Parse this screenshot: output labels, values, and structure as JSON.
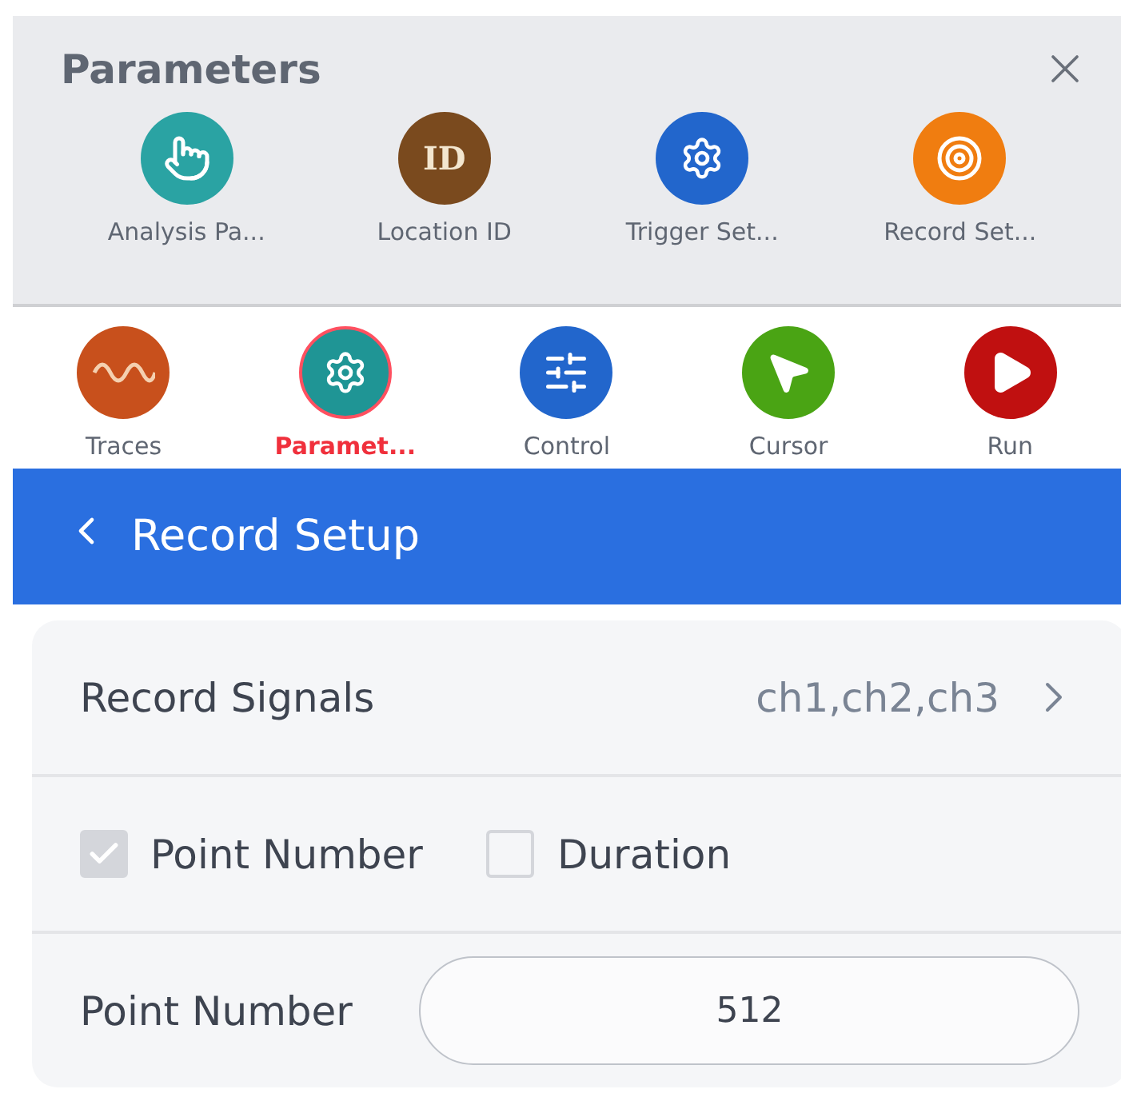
{
  "panel": {
    "title": "Parameters"
  },
  "shortcuts": [
    {
      "label": "Analysis Pa...",
      "kind": "touch",
      "color": "#2aa3a3"
    },
    {
      "label": "Location ID",
      "kind": "id",
      "color": "#7a4a1e",
      "glyph": "ID"
    },
    {
      "label": "Trigger Set...",
      "kind": "gear",
      "color": "#2266cc"
    },
    {
      "label": "Record Set...",
      "kind": "target",
      "color": "#f07d10"
    }
  ],
  "tabs": [
    {
      "label": "Traces",
      "kind": "wave",
      "color": "#c8501c",
      "selected": false
    },
    {
      "label": "Paramet...",
      "kind": "params",
      "color": "#1f9595",
      "selected": true
    },
    {
      "label": "Control",
      "kind": "sliders",
      "color": "#2266cc",
      "selected": false
    },
    {
      "label": "Cursor",
      "kind": "cursor",
      "color": "#4aa414",
      "selected": false
    },
    {
      "label": "Run",
      "kind": "run",
      "color": "#c01010",
      "selected": false
    }
  ],
  "header": {
    "title": "Record Setup"
  },
  "record_signals": {
    "label": "Record Signals",
    "value": "ch1,ch2,ch3"
  },
  "mode": [
    {
      "label": "Point Number",
      "checked": true
    },
    {
      "label": "Duration",
      "checked": false
    }
  ],
  "point_number": {
    "label": "Point Number",
    "value": "512"
  }
}
